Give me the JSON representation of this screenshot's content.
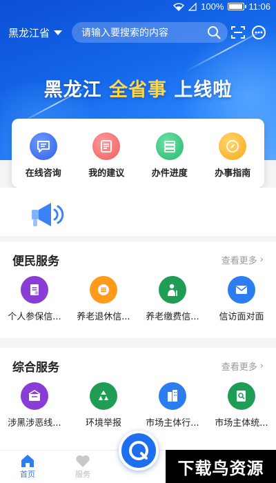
{
  "status_bar": {
    "battery_text": "100%",
    "battery_level": 1.0,
    "time": "11:06"
  },
  "header": {
    "province": "黑龙江省",
    "search_placeholder": "请输入要搜索的内容"
  },
  "banner": {
    "part1": "黑龙江",
    "highlight": "全省事",
    "part2": "上线啦"
  },
  "quick_actions": [
    {
      "label": "在线咨询",
      "icon": "chat-icon",
      "color": "#3b6ff0"
    },
    {
      "label": "我的建议",
      "icon": "document-icon",
      "color": "#ff6b6b"
    },
    {
      "label": "办件进度",
      "icon": "list-icon",
      "color": "#2ec17a"
    },
    {
      "label": "办事指南",
      "icon": "compass-icon",
      "color": "#ffb31a"
    }
  ],
  "notice": {
    "icon": "megaphone-icon"
  },
  "convenience": {
    "title": "便民服务",
    "more": "查看更多",
    "items": [
      {
        "label": "个人参保信...",
        "icon": "insurance-doc-icon",
        "color": "#8a3dd6"
      },
      {
        "label": "养老退休信...",
        "icon": "pension-icon",
        "color": "#ff9a1a"
      },
      {
        "label": "养老缴费信...",
        "icon": "elder-person-icon",
        "color": "#1f9d55"
      },
      {
        "label": "信访面对面",
        "icon": "mail-icon",
        "color": "#2b7df0"
      }
    ]
  },
  "comprehensive": {
    "title": "综合服务",
    "more": "查看更多",
    "items": [
      {
        "label": "涉黑涉恶线...",
        "icon": "report-box-icon",
        "color": "#8a3dd6"
      },
      {
        "label": "环境举报",
        "icon": "recycle-icon",
        "color": "#1f9d55"
      },
      {
        "label": "市场主体行...",
        "icon": "building-icon",
        "color": "#2b7df0"
      },
      {
        "label": "市场主体统...",
        "icon": "magnifier-doc-icon",
        "color": "#1f9d55"
      }
    ]
  },
  "bottom_nav": [
    {
      "label": "首页",
      "icon": "home-icon",
      "active": true
    },
    {
      "label": "服务",
      "icon": "heart-icon",
      "active": false
    }
  ],
  "watermark": "下载鸟资源",
  "colors": {
    "brand_blue": "#1e6ff0",
    "active_nav": "#2b7df0",
    "inactive_nav": "#bbbbbb"
  }
}
